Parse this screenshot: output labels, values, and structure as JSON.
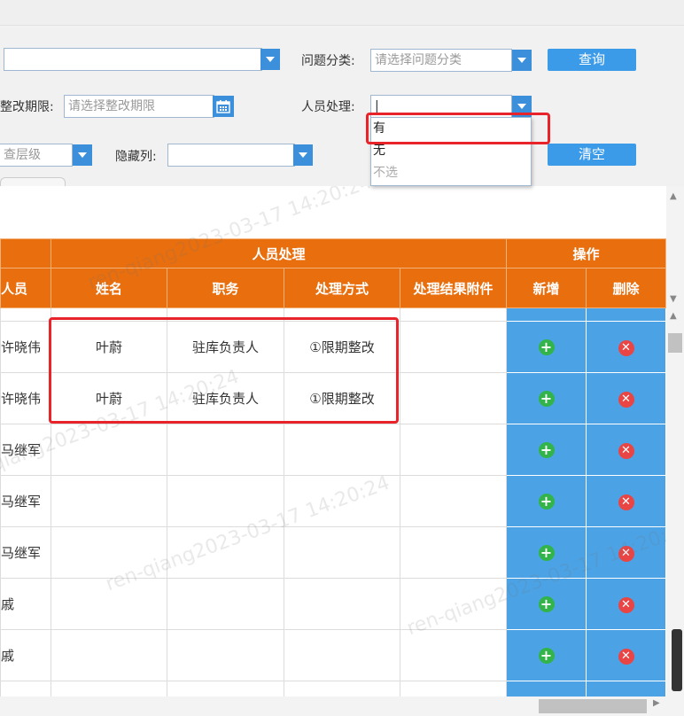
{
  "filters": {
    "category_label": "问题分类:",
    "category_placeholder": "请选择问题分类",
    "query_button": "查询",
    "deadline_label": "整改期限:",
    "deadline_placeholder": "请选择整改期限",
    "personnel_label": "人员处理:",
    "personnel_value": "|",
    "level_placeholder": "查层级",
    "hide_col_label": "隐藏列:",
    "clear_button": "清空"
  },
  "dropdown_options": [
    "有",
    "无",
    "不选"
  ],
  "table": {
    "group_header": "人员处理",
    "op_header": "操作",
    "col_left_cut": "人员",
    "columns": [
      "姓名",
      "职务",
      "处理方式",
      "处理结果附件",
      "新增",
      "删除"
    ],
    "rows": [
      {
        "person": "许晓伟",
        "name": "叶蔚",
        "position": "驻库负责人",
        "method": "①限期整改",
        "attachment": ""
      },
      {
        "person": "许晓伟",
        "name": "叶蔚",
        "position": "驻库负责人",
        "method": "①限期整改",
        "attachment": ""
      },
      {
        "person": "马继军",
        "name": "",
        "position": "",
        "method": "",
        "attachment": ""
      },
      {
        "person": "马继军",
        "name": "",
        "position": "",
        "method": "",
        "attachment": ""
      },
      {
        "person": "马继军",
        "name": "",
        "position": "",
        "method": "",
        "attachment": ""
      },
      {
        "person": "戚",
        "name": "",
        "position": "",
        "method": "",
        "attachment": ""
      },
      {
        "person": "戚",
        "name": "",
        "position": "",
        "method": "",
        "attachment": ""
      }
    ]
  },
  "watermark_text": "ren-qiang2023-03-17 14:20:24",
  "icons": {
    "add": "plus-circle-icon",
    "delete": "x-circle-icon",
    "calendar": "calendar-icon"
  },
  "colors": {
    "header_orange": "#e86e0e",
    "button_blue": "#3b9be8",
    "highlight_red": "#e8242a"
  }
}
